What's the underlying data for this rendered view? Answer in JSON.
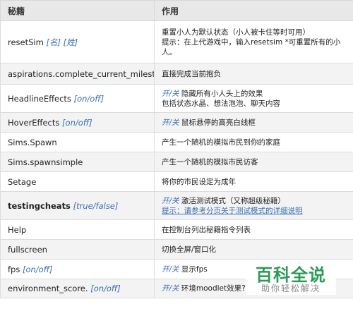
{
  "header": {
    "col1": "秘籍",
    "col2": "作用"
  },
  "rows": [
    {
      "cmd": "resetSim",
      "params": "[名] [姓]",
      "desc1": "重置小人为默认状态（小人被卡住等时可用）",
      "desc2": "提示：在上代游戏中，输入resetsim *可重置所有的小",
      "desc3": "人。"
    },
    {
      "cmd": "aspirations.complete_current_milestone",
      "desc1": "直接完成当前抱负"
    },
    {
      "cmd": "HeadlineEffects",
      "params": "[on/off]",
      "toggle": "开/关",
      "desc1": "隐藏所有小人头上的效果",
      "desc2": "包括状态水晶、想法泡泡、聊天内容"
    },
    {
      "cmd": "HoverEffects",
      "params": "[on/off]",
      "toggle": "开/关",
      "desc1": "鼠标悬停的高亮白线框"
    },
    {
      "cmd": "Sims.Spawn",
      "desc1": "产生一个随机的模拟市民到你的家庭"
    },
    {
      "cmd": "Sims.spawnsimple",
      "desc1": "产生一个随机的模拟市民访客"
    },
    {
      "cmd": "Setage",
      "desc1": "将你的市民设定为成年"
    },
    {
      "cmd": "testingcheats",
      "params": "[true/false]",
      "toggle": "开/关",
      "desc1": "激活测试模式（又称超级秘籍）",
      "link": "提示：请参考分页关于测试模式的详细说明"
    },
    {
      "cmd": "Help",
      "desc1": "在控制台列出秘籍指令列表"
    },
    {
      "cmd": "fullscreen",
      "desc1": "切换全屏/窗口化"
    },
    {
      "cmd": "fps",
      "params": "[on/off]",
      "toggle": "开/关",
      "desc1": "显示fps"
    },
    {
      "cmd": "environment_score.",
      "params": "[on/off]",
      "toggle": "开/关",
      "desc1": "环境moodlet效果?"
    }
  ],
  "watermark": {
    "title": "百科全说",
    "subtitle": "助你轻松解决"
  }
}
